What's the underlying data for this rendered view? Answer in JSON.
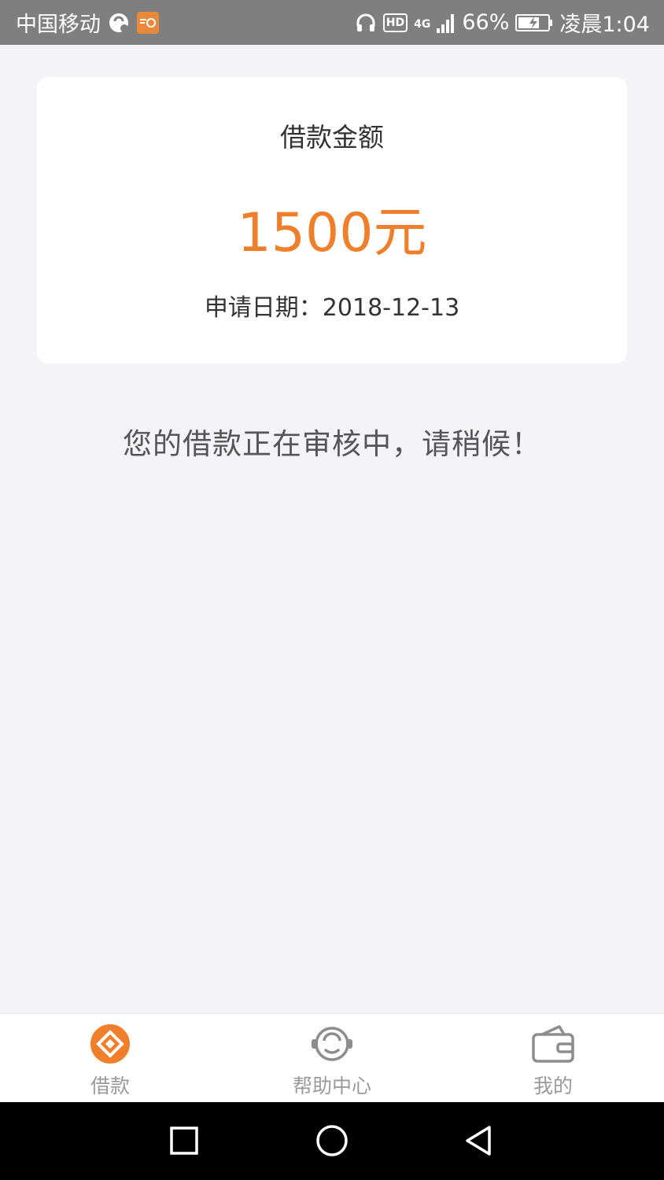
{
  "status_bar": {
    "carrier": "中国移动",
    "network": "4G",
    "battery": "66%",
    "time": "凌晨1:04",
    "hd_label": "HD",
    "icons": [
      "chat-icon",
      "app-notification-icon",
      "headset-icon",
      "hd-icon",
      "signal-icon",
      "battery-charging-icon"
    ]
  },
  "loan_card": {
    "label": "借款金额",
    "amount": "1500元",
    "date": "申请日期：2018-12-13"
  },
  "status_message": "您的借款正在审核中，请稍候！",
  "tabs": [
    {
      "label": "借款",
      "icon": "loan-diamond-icon",
      "active": true
    },
    {
      "label": "帮助中心",
      "icon": "customer-service-icon",
      "active": false
    },
    {
      "label": "我的",
      "icon": "wallet-icon",
      "active": false
    }
  ],
  "nav": [
    "recent-apps-icon",
    "home-icon",
    "back-icon"
  ],
  "colors": {
    "accent": "#f07f2b",
    "tab_inactive": "#9a9a9a",
    "background": "#f3f3f8"
  }
}
